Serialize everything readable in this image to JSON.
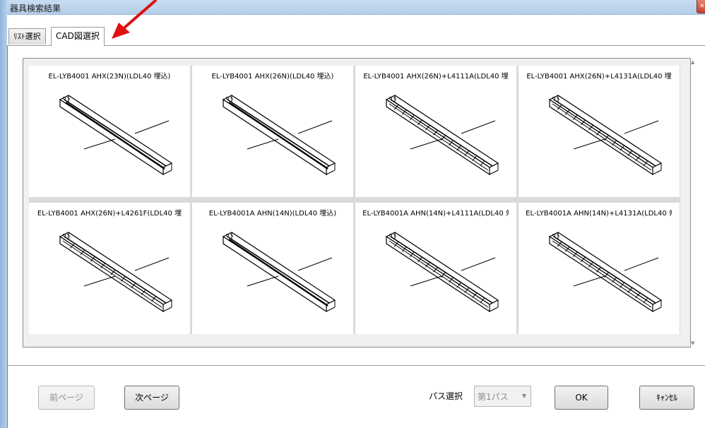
{
  "window": {
    "title": "器具検索結果",
    "close_icon": "close-icon"
  },
  "tabs": [
    {
      "label": "ﾘｽﾄ選択",
      "active": false
    },
    {
      "label": "CAD図選択",
      "active": true
    }
  ],
  "items": [
    {
      "label": "EL-LYB4001 AHX(23N)(LDL40 埋込)",
      "type": "plain"
    },
    {
      "label": "EL-LYB4001 AHX(26N)(LDL40 埋込)",
      "type": "plain"
    },
    {
      "label": "EL-LYB4001 AHX(26N)+L4111A(LDL40 埋",
      "type": "louver"
    },
    {
      "label": "EL-LYB4001 AHX(26N)+L4131A(LDL40 埋",
      "type": "louver"
    },
    {
      "label": "EL-LYB4001 AHX(26N)+L4261F(LDL40 埋",
      "type": "louver-wide"
    },
    {
      "label": "EL-LYB4001A AHN(14N)(LDL40 埋込)",
      "type": "plain"
    },
    {
      "label": "EL-LYB4001A AHN(14N)+L4111A(LDL40 ﾀ",
      "type": "louver"
    },
    {
      "label": "EL-LYB4001A AHN(14N)+L4131A(LDL40 ﾀ",
      "type": "louver"
    }
  ],
  "footer": {
    "prev_label": "前ページ",
    "next_label": "次ページ",
    "path_label": "パス選択",
    "path_value": "第1パス",
    "ok_label": "OK",
    "cancel_label": "ｷｬﾝｾﾙ"
  },
  "colors": {
    "annotation_arrow": "#e01010",
    "accent": "#b5cde8"
  }
}
